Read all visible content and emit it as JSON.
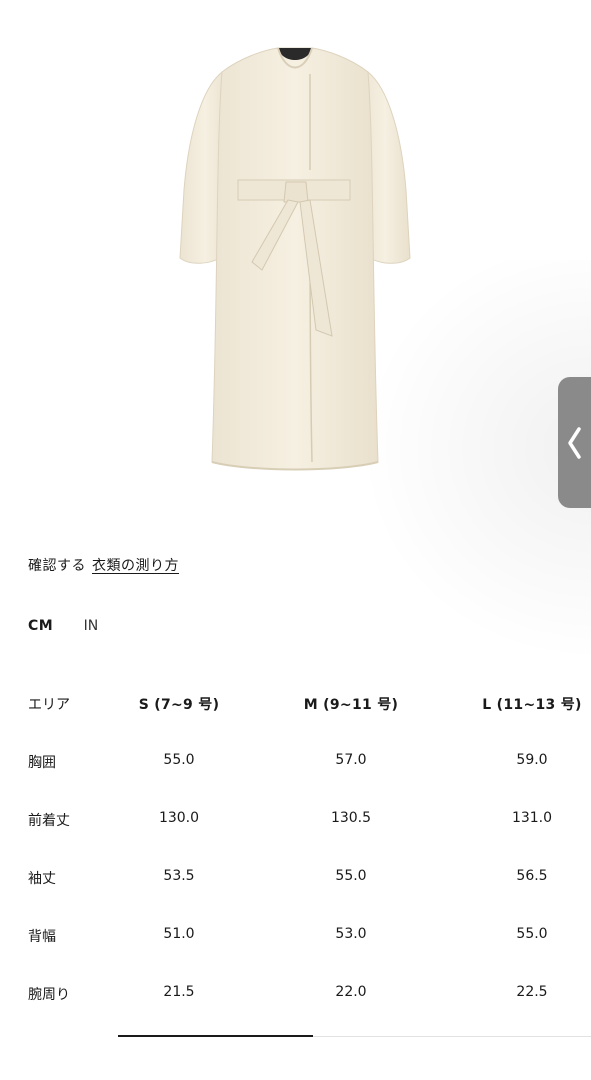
{
  "guide": {
    "prefix": "確認する",
    "link": "衣類の測り方"
  },
  "units": {
    "cm": "CM",
    "in": "IN",
    "selected": "CM"
  },
  "table": {
    "headers": [
      "エリア",
      "S (7~9 号)",
      "M (9~11 号)",
      "L (11~13 号)"
    ],
    "rows": [
      [
        "胸囲",
        "55.0",
        "57.0",
        "59.0"
      ],
      [
        "前着丈",
        "130.0",
        "130.5",
        "131.0"
      ],
      [
        "袖丈",
        "53.5",
        "55.0",
        "56.5"
      ],
      [
        "背幅",
        "51.0",
        "53.0",
        "55.0"
      ],
      [
        "腕周り",
        "21.5",
        "22.0",
        "22.5"
      ]
    ]
  },
  "scroll": {
    "position_fraction": 0.0,
    "visible_fraction": 0.41
  },
  "colors": {
    "coat": "#f3ecdc",
    "handle": "#8a8a8a",
    "text": "#1a1a1a"
  }
}
